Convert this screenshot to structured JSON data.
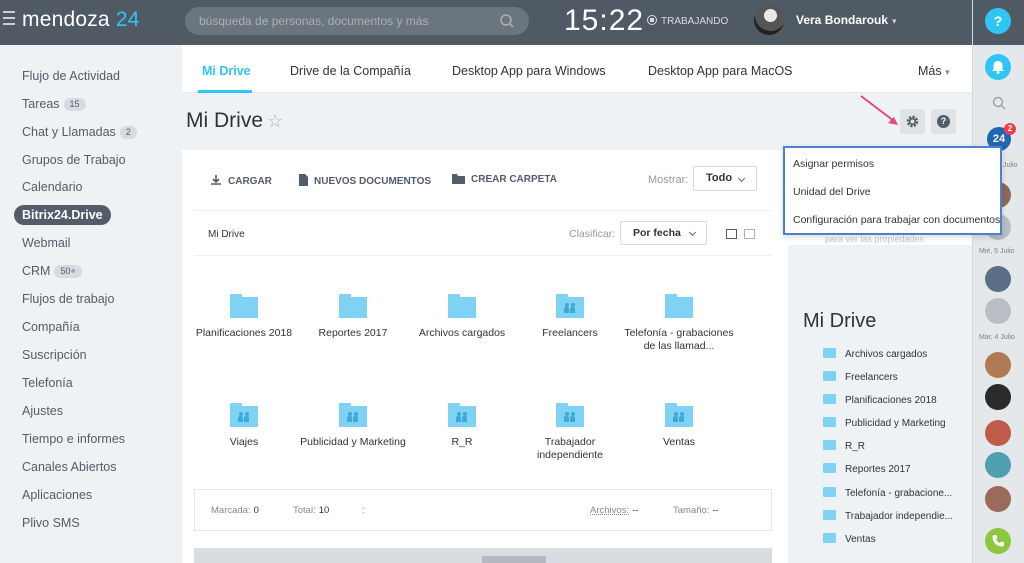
{
  "header": {
    "logo_main": "mendoza",
    "logo_num": "24",
    "search_placeholder": "búsqueda de personas, documentos y más",
    "clock": "15:22",
    "status": "TRABAJANDO",
    "user_name": "Vera Bondarouk"
  },
  "right_strip": {
    "help": "?",
    "b24_badge": "2",
    "b24_label": "24",
    "dates": [
      "Julio",
      "Mié, 5 Julio",
      "Mar, 4 Julio"
    ]
  },
  "sidebar": {
    "items": [
      {
        "label": "Flujo de Actividad",
        "count": ""
      },
      {
        "label": "Tareas",
        "count": "15"
      },
      {
        "label": "Chat y Llamadas",
        "count": "2"
      },
      {
        "label": "Grupos de Trabajo",
        "count": ""
      },
      {
        "label": "Calendario",
        "count": ""
      },
      {
        "label": "Bitrix24.Drive",
        "count": ""
      },
      {
        "label": "Webmail",
        "count": ""
      },
      {
        "label": "CRM",
        "count": "50+"
      },
      {
        "label": "Flujos de trabajo",
        "count": ""
      },
      {
        "label": "Compañía",
        "count": ""
      },
      {
        "label": "Suscripción",
        "count": ""
      },
      {
        "label": "Telefonía",
        "count": ""
      },
      {
        "label": "Ajustes",
        "count": ""
      },
      {
        "label": "Tiempo e informes",
        "count": ""
      },
      {
        "label": "Canales Abiertos",
        "count": ""
      },
      {
        "label": "Aplicaciones",
        "count": ""
      },
      {
        "label": "Plivo SMS",
        "count": ""
      }
    ],
    "active_index": 5
  },
  "tabs": [
    "Mi Drive",
    "Drive de la Compañía",
    "Desktop App para Windows",
    "Desktop App para MacOS",
    "Más"
  ],
  "page": {
    "title": "Mi Drive",
    "star": "☆"
  },
  "settings_menu": [
    "Asignar permisos",
    "Unidad del Drive",
    "Configuración para trabajar con documentos"
  ],
  "toolbar": {
    "upload": "CARGAR",
    "new_docs": "NUEVOS DOCUMENTOS",
    "new_folder": "CREAR CARPETA",
    "show_label": "Mostrar:",
    "show_value": "Todo",
    "breadcrumb": "Mi Drive",
    "sort_label": "Clasificar:",
    "sort_value": "Por fecha"
  },
  "folders": [
    {
      "name": "Planificaciones 2018",
      "shared": false
    },
    {
      "name": "Reportes 2017",
      "shared": false
    },
    {
      "name": "Archivos cargados",
      "shared": false
    },
    {
      "name": "Freelancers",
      "shared": true
    },
    {
      "name": "Telefonía - grabaciones de las llamad...",
      "shared": false
    },
    {
      "name": "Viajes",
      "shared": true
    },
    {
      "name": "Publicidad y Marketing",
      "shared": true
    },
    {
      "name": "R_R",
      "shared": true
    },
    {
      "name": "Trabajador independiente",
      "shared": true
    },
    {
      "name": "Ventas",
      "shared": true
    }
  ],
  "footer": {
    "marked_label": "Marcada:",
    "marked_value": "0",
    "total_label": "Total:",
    "total_value": "10",
    "sep": ":",
    "files_label": "Archivos:",
    "files_value": "--",
    "size_label": "Tamaño:",
    "size_value": "--"
  },
  "right_panel": {
    "faded_text": "para ver las propiedades",
    "title": "Mi Drive",
    "items": [
      "Archivos cargados",
      "Freelancers",
      "Planificaciones 2018",
      "Publicidad y Marketing",
      "R_R",
      "Reportes 2017",
      "Telefonía - grabacione...",
      "Trabajador independie...",
      "Ventas"
    ]
  },
  "colors": {
    "accent": "#2fc6f6",
    "topbar": "#4f5a64",
    "folder": "#7fd2f3",
    "menu_border": "#4e7fd1",
    "arrow": "#e8467c"
  }
}
